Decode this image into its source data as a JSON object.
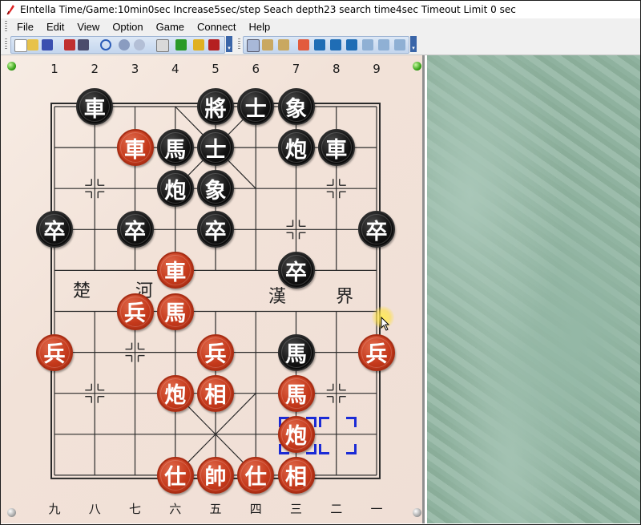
{
  "window": {
    "title": "EIntella Time/Game:10min0sec Increase5sec/step Seach depth23 search time4sec Timeout Limit 0 sec",
    "app_icon": "feather-icon"
  },
  "menu": {
    "items": [
      "File",
      "Edit",
      "View",
      "Option",
      "Game",
      "Connect",
      "Help"
    ]
  },
  "toolbar": {
    "group1": [
      "new-icon",
      "open-icon",
      "save-icon",
      "print-icon",
      "printer-setup-icon",
      "search-icon",
      "stop-icon",
      "refresh-icon",
      "edit-icon",
      "move-icon",
      "lock-icon",
      "hammer-icon"
    ],
    "group2": [
      "copy-icon",
      "paste-icon",
      "paste-board-icon",
      "undo-icon",
      "first-move-icon",
      "prev-fast-icon",
      "prev-icon",
      "next-icon",
      "next-fast-icon",
      "last-move-icon"
    ]
  },
  "board": {
    "top_numbers": [
      "1",
      "2",
      "3",
      "4",
      "5",
      "6",
      "7",
      "8",
      "9"
    ],
    "bottom_numbers": [
      "九",
      "八",
      "七",
      "六",
      "五",
      "四",
      "三",
      "二",
      "一"
    ],
    "river_text": [
      "楚",
      "河",
      "漢",
      "界"
    ],
    "colors": {
      "red": "#c5391b",
      "black": "#121212",
      "selection": "#1b2bd6",
      "marble": "#96b8a5"
    },
    "pieces": [
      {
        "char": "車",
        "side": "black",
        "file": 2,
        "rank": 0
      },
      {
        "char": "將",
        "side": "black",
        "file": 5,
        "rank": 0
      },
      {
        "char": "士",
        "side": "black",
        "file": 6,
        "rank": 0
      },
      {
        "char": "象",
        "side": "black",
        "file": 7,
        "rank": 0
      },
      {
        "char": "車",
        "side": "red",
        "file": 3,
        "rank": 1
      },
      {
        "char": "馬",
        "side": "black",
        "file": 4,
        "rank": 1
      },
      {
        "char": "士",
        "side": "black",
        "file": 5,
        "rank": 1
      },
      {
        "char": "炮",
        "side": "black",
        "file": 7,
        "rank": 1
      },
      {
        "char": "車",
        "side": "black",
        "file": 8,
        "rank": 1
      },
      {
        "char": "炮",
        "side": "black",
        "file": 4,
        "rank": 2
      },
      {
        "char": "象",
        "side": "black",
        "file": 5,
        "rank": 2
      },
      {
        "char": "卒",
        "side": "black",
        "file": 1,
        "rank": 3
      },
      {
        "char": "卒",
        "side": "black",
        "file": 3,
        "rank": 3
      },
      {
        "char": "卒",
        "side": "black",
        "file": 5,
        "rank": 3
      },
      {
        "char": "卒",
        "side": "black",
        "file": 9,
        "rank": 3
      },
      {
        "char": "車",
        "side": "red",
        "file": 4,
        "rank": 4
      },
      {
        "char": "卒",
        "side": "black",
        "file": 7,
        "rank": 4
      },
      {
        "char": "兵",
        "side": "red",
        "file": 3,
        "rank": 5
      },
      {
        "char": "馬",
        "side": "red",
        "file": 4,
        "rank": 5
      },
      {
        "char": "兵",
        "side": "red",
        "file": 1,
        "rank": 6
      },
      {
        "char": "兵",
        "side": "red",
        "file": 5,
        "rank": 6
      },
      {
        "char": "馬",
        "side": "black",
        "file": 7,
        "rank": 6
      },
      {
        "char": "兵",
        "side": "red",
        "file": 9,
        "rank": 6
      },
      {
        "char": "炮",
        "side": "red",
        "file": 4,
        "rank": 7
      },
      {
        "char": "相",
        "side": "red",
        "file": 5,
        "rank": 7
      },
      {
        "char": "馬",
        "side": "red",
        "file": 7,
        "rank": 7
      },
      {
        "char": "炮",
        "side": "red",
        "file": 7,
        "rank": 8
      },
      {
        "char": "仕",
        "side": "red",
        "file": 4,
        "rank": 9
      },
      {
        "char": "帥",
        "side": "red",
        "file": 5,
        "rank": 9
      },
      {
        "char": "仕",
        "side": "red",
        "file": 6,
        "rank": 9
      },
      {
        "char": "相",
        "side": "red",
        "file": 7,
        "rank": 9
      }
    ],
    "selection_from": {
      "file": 8,
      "rank": 8
    },
    "selection_to": {
      "file": 7,
      "rank": 8
    }
  }
}
